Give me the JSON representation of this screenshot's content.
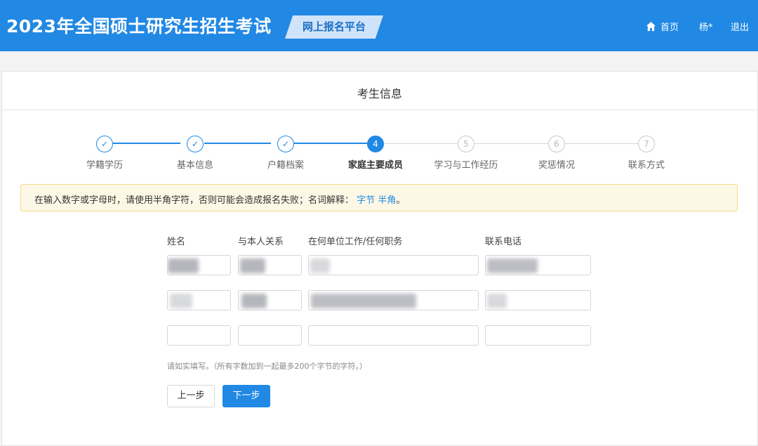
{
  "header": {
    "title": "2023年全国硕士研究生招生考试",
    "platform": "网上报名平台",
    "home_icon": "home-icon",
    "home_label": "首页",
    "user_name": "杨*",
    "logout_label": "退出",
    "accent_color": "#2188e4"
  },
  "card": {
    "title": "考生信息"
  },
  "steps": [
    {
      "number": "✓",
      "label": "学籍学历",
      "state": "done"
    },
    {
      "number": "✓",
      "label": "基本信息",
      "state": "done"
    },
    {
      "number": "✓",
      "label": "户籍档案",
      "state": "done"
    },
    {
      "number": "4",
      "label": "家庭主要成员",
      "state": "active"
    },
    {
      "number": "5",
      "label": "学习与工作经历",
      "state": "todo"
    },
    {
      "number": "6",
      "label": "奖惩情况",
      "state": "todo"
    },
    {
      "number": "7",
      "label": "联系方式",
      "state": "todo"
    }
  ],
  "notice": {
    "text": "在输入数字或字母时，请使用半角字符，否则可能会造成报名失败；名词解释：",
    "link_byte": "字节",
    "link_halfwidth": "半角",
    "end": "。"
  },
  "table": {
    "columns": [
      "姓名",
      "与本人关系",
      "在何单位工作/任何职务",
      "联系电话"
    ],
    "rows": [
      {
        "name": "",
        "relation": "",
        "work": "",
        "phone": "",
        "redacted": true
      },
      {
        "name": "",
        "relation": "",
        "work": "",
        "phone": "",
        "redacted": true
      },
      {
        "name": "",
        "relation": "",
        "work": "",
        "phone": "",
        "redacted": false
      }
    ]
  },
  "hint": "请如实填写。（所有字数加到一起最多200个字节的字符。）",
  "buttons": {
    "prev": "上一步",
    "next": "下一步"
  }
}
